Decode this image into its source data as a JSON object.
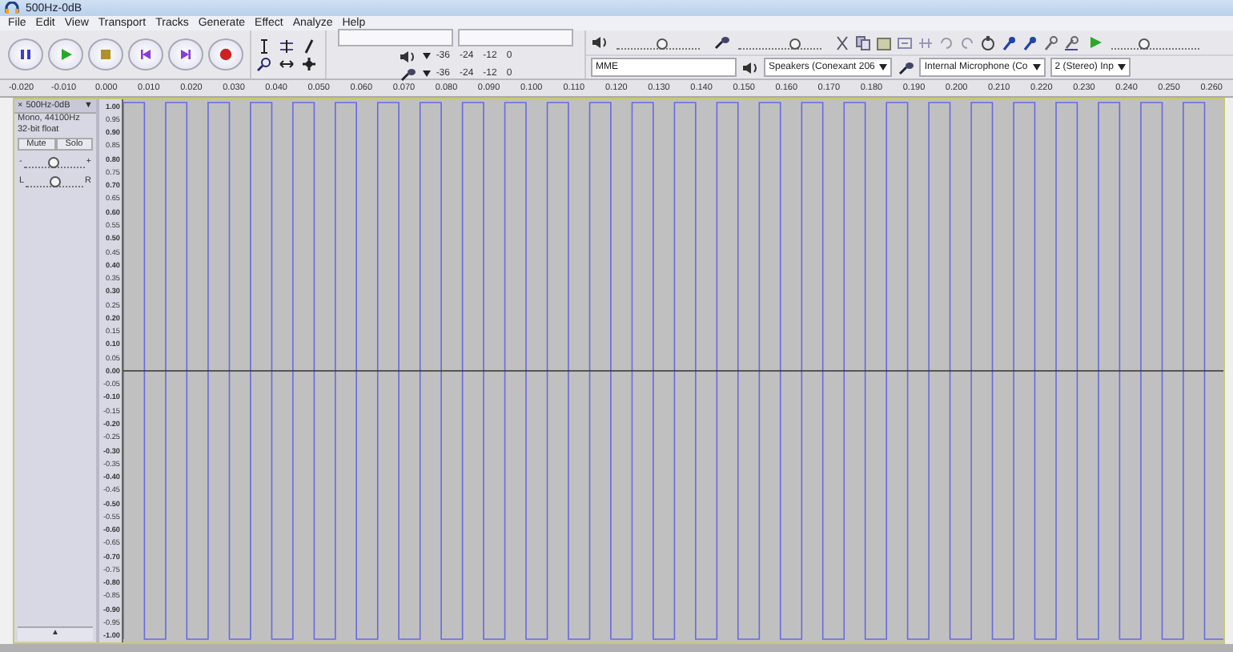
{
  "window": {
    "title": "500Hz-0dB"
  },
  "menu": [
    "File",
    "Edit",
    "View",
    "Transport",
    "Tracks",
    "Generate",
    "Effect",
    "Analyze",
    "Help"
  ],
  "transport": [
    {
      "kind": "pause"
    },
    {
      "kind": "play"
    },
    {
      "kind": "stop"
    },
    {
      "kind": "skip-start"
    },
    {
      "kind": "skip-end"
    },
    {
      "kind": "record"
    }
  ],
  "meters": [
    {
      "kind": "playback",
      "ticks": [
        "-36",
        "-24",
        "-12",
        "0"
      ]
    },
    {
      "kind": "record",
      "ticks": [
        "-36",
        "-24",
        "-12",
        "0"
      ]
    }
  ],
  "mixer": [
    {
      "kind": "output",
      "level": 0.55
    },
    {
      "kind": "input",
      "level": 0.7
    }
  ],
  "play_at_speed": {
    "level": 0.35
  },
  "devices": {
    "host": "MME",
    "output": "Speakers (Conexant 206",
    "input": "Internal Microphone (Co",
    "channels": "2 (Stereo) Inp"
  },
  "ruler": [
    "-0.020",
    "-0.010",
    "0.000",
    "0.010",
    "0.020",
    "0.030",
    "0.040",
    "0.050",
    "0.060",
    "0.070",
    "0.080",
    "0.090",
    "0.100",
    "0.110",
    "0.120",
    "0.130",
    "0.140",
    "0.150",
    "0.160",
    "0.170",
    "0.180",
    "0.190",
    "0.200",
    "0.210",
    "0.220",
    "0.230",
    "0.240",
    "0.250",
    "0.260"
  ],
  "track": {
    "close": "×",
    "name": "500Hz-0dB",
    "menu": "▼",
    "info": [
      "Mono, 44100Hz",
      "32-bit float"
    ],
    "buttons": [
      "Mute",
      "Solo"
    ],
    "gain": {
      "min": "-",
      "max": "+",
      "level": 0.5
    },
    "pan": {
      "min": "L",
      "max": "R",
      "level": 0.5
    },
    "collapse": "▲",
    "scale": [
      "1.00",
      "0.95",
      "0.90",
      "0.85",
      "0.80",
      "0.75",
      "0.70",
      "0.65",
      "0.60",
      "0.55",
      "0.50",
      "0.45",
      "0.40",
      "0.35",
      "0.30",
      "0.25",
      "0.20",
      "0.15",
      "0.10",
      "0.05",
      "0.00",
      "-0.05",
      "-0.10",
      "-0.15",
      "-0.20",
      "-0.25",
      "-0.30",
      "-0.35",
      "-0.40",
      "-0.45",
      "-0.50",
      "-0.55",
      "-0.60",
      "-0.65",
      "-0.70",
      "-0.75",
      "-0.80",
      "-0.85",
      "-0.90",
      "-0.95",
      "-1.00"
    ]
  }
}
